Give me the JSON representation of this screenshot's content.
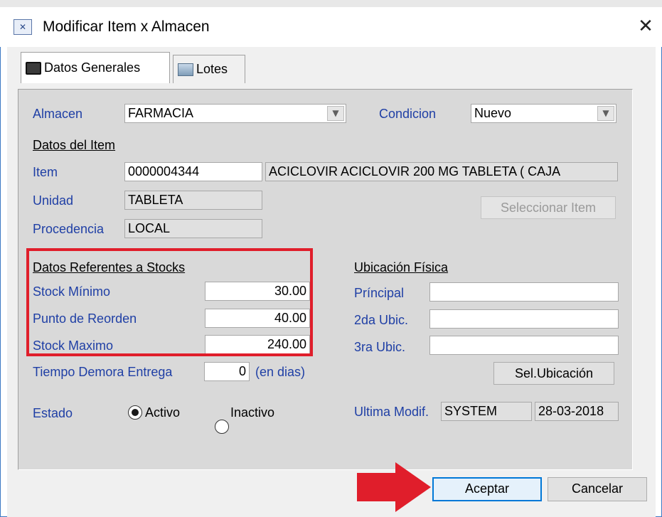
{
  "window": {
    "title": "Modificar Item x Almacen",
    "close_glyph": "✕",
    "title_icon": "app-icon"
  },
  "tabs": [
    {
      "label": "Datos Generales",
      "icon": "book-icon",
      "active": true
    },
    {
      "label": "Lotes",
      "icon": "database-icon",
      "active": false
    }
  ],
  "form": {
    "almacen_label": "Almacen",
    "almacen_value": "FARMACIA",
    "condicion_label": "Condicion",
    "condicion_value": "Nuevo",
    "datos_item_heading": "Datos del Item",
    "item_label": "Item",
    "item_code": "0000004344",
    "item_description": "ACICLOVIR  ACICLOVIR  200 MG TABLETA ( CAJA",
    "unidad_label": "Unidad",
    "unidad_value": "TABLETA",
    "procedencia_label": "Procedencia",
    "procedencia_value": "LOCAL",
    "seleccionar_item_button": "Seleccionar Item",
    "stocks_heading": "Datos Referentes a Stocks",
    "stock_minimo_label": "Stock Mínimo",
    "stock_minimo_value": "30.00",
    "punto_reorden_label": "Punto de Reorden",
    "punto_reorden_value": "40.00",
    "stock_maximo_label": "Stock Maximo",
    "stock_maximo_value": "240.00",
    "tiempo_demora_label": "Tiempo Demora Entrega",
    "tiempo_demora_value": "0",
    "tiempo_demora_unit": "(en dias)",
    "ubicacion_heading": "Ubicación Física",
    "principal_label": "Príncipal",
    "principal_value": "",
    "ubic2_label": "2da Ubic.",
    "ubic2_value": "",
    "ubic3_label": "3ra Ubic.",
    "ubic3_value": "",
    "sel_ubicacion_button": "Sel.Ubicación",
    "estado_label": "Estado",
    "estado_options": [
      {
        "label": "Activo",
        "selected": true
      },
      {
        "label": "Inactivo",
        "selected": false
      }
    ],
    "ultima_modif_label": "Ultima Modif.",
    "ultima_modif_user": "SYSTEM",
    "ultima_modif_date": "28-03-2018"
  },
  "footer": {
    "aceptar_button": "Aceptar",
    "cancelar_button": "Cancelar"
  },
  "colors": {
    "label_blue": "#1f3fa5",
    "highlight_red": "#e01e2b",
    "default_button_border": "#0078d7"
  }
}
